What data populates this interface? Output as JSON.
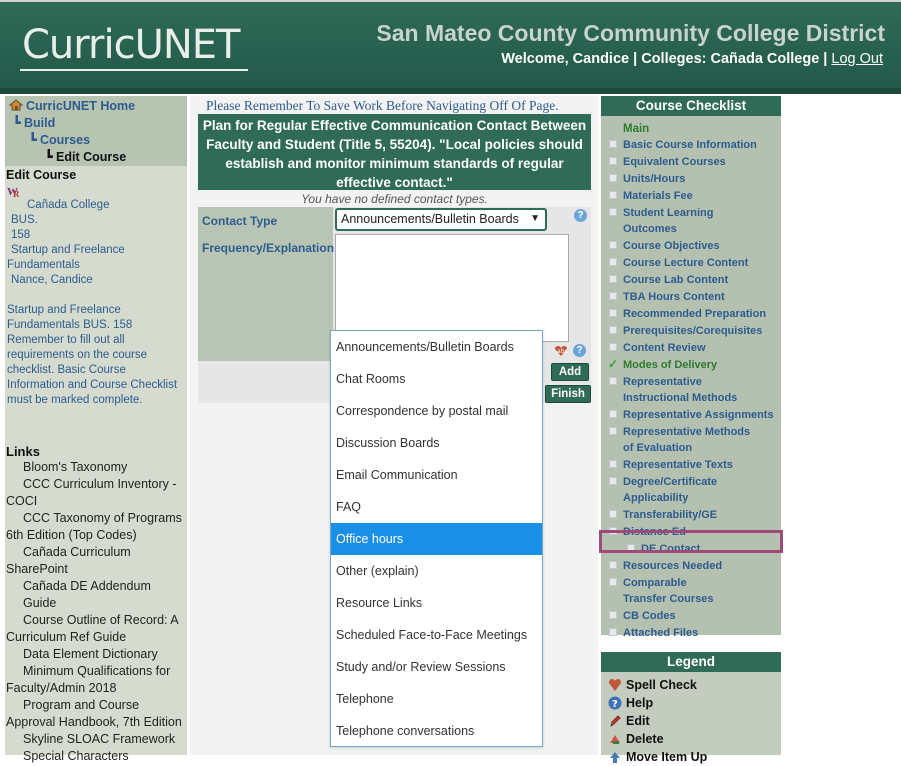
{
  "header": {
    "logo_text": "CurricUNET",
    "district": "San Mateo County Community College District",
    "welcome": "Welcome, Candice | Colleges: Cañada College |",
    "logout": "Log Out"
  },
  "breadcrumbs": {
    "home": "CurricUNET Home",
    "build": "Build",
    "courses": "Courses",
    "edit_course": "Edit Course"
  },
  "left": {
    "edit_course_title": "Edit Course",
    "info_lines": [
      "Cañada College",
      "BUS.",
      "158",
      "Startup and Freelance",
      "Fundamentals",
      "Nance, Candice"
    ],
    "note": "Startup and Freelance Fundamentals BUS. 158 Remember to fill out all requirements on the course checklist. Basic Course Information and Course Checklist must be marked complete.",
    "links_title": "Links",
    "links": [
      "Bloom's Taxonomy",
      "CCC Curriculum Inventory - COCI",
      "CCC Taxonomy of Programs 6th Edition (Top Codes)",
      "Cañada Curriculum SharePoint",
      "Cañada DE Addendum Guide",
      "Course Outline of Record: A Curriculum Ref Guide",
      "Data Element Dictionary",
      "Minimum Qualifications for Faculty/Admin 2018",
      "Program and Course Approval Handbook, 7th Edition",
      "Skyline SLOAC Framework",
      "Special Characters"
    ]
  },
  "main": {
    "remember": "Please Remember To Save Work Before Navigating Off Of Page.",
    "plan_title": "Plan for Regular Effective Communication Contact Between Faculty and Student (Title 5, 55204). \"Local policies should establish and monitor minimum standards of regular effective contact.\"",
    "no_defined": "You have no defined contact types.",
    "contact_type_label": "Contact Type",
    "contact_type_value": "Announcements/Bulletin Boards",
    "frequency_label": "Frequency/Explanation",
    "add_label": "Add",
    "finish_label": "Finish"
  },
  "dropdown": {
    "options": [
      "Announcements/Bulletin Boards",
      "Chat Rooms",
      "Correspondence by postal mail",
      "Discussion Boards",
      "Email Communication",
      "FAQ",
      "Office hours",
      "Other (explain)",
      "Resource Links",
      "Scheduled Face-to-Face Meetings",
      "Study and/or Review Sessions",
      "Telephone",
      "Telephone conversations"
    ],
    "highlighted": "Office hours"
  },
  "checklist": {
    "title": "Course Checklist",
    "main": "Main",
    "items": [
      "Basic Course Information",
      "Equivalent Courses",
      "Units/Hours",
      "Materials Fee",
      "Student Learning Outcomes",
      "Course Objectives",
      "Course Lecture Content",
      "Course Lab Content",
      "TBA Hours Content",
      "Recommended Preparation",
      "Prerequisites/Corequisites",
      "Content Review",
      "Modes of Delivery",
      "Representative Instructional Methods",
      "Representative Assignments",
      "Representative Methods of Evaluation",
      "Representative Texts",
      "Degree/Certificate Applicability",
      "Transferability/GE",
      "Distance Ed",
      "DE Contact",
      "Resources Needed",
      "Comparable Transfer Courses",
      "CB Codes",
      "Attached Files"
    ]
  },
  "legend": {
    "title": "Legend",
    "items": [
      "Spell Check",
      "Help",
      "Edit",
      "Delete",
      "Move Item Up"
    ]
  },
  "colors": {
    "header_green": "#2f6b56",
    "link_blue": "#2e5b8e",
    "highlight_blue": "#1a8fe6",
    "focus_border": "#a04a7a"
  }
}
